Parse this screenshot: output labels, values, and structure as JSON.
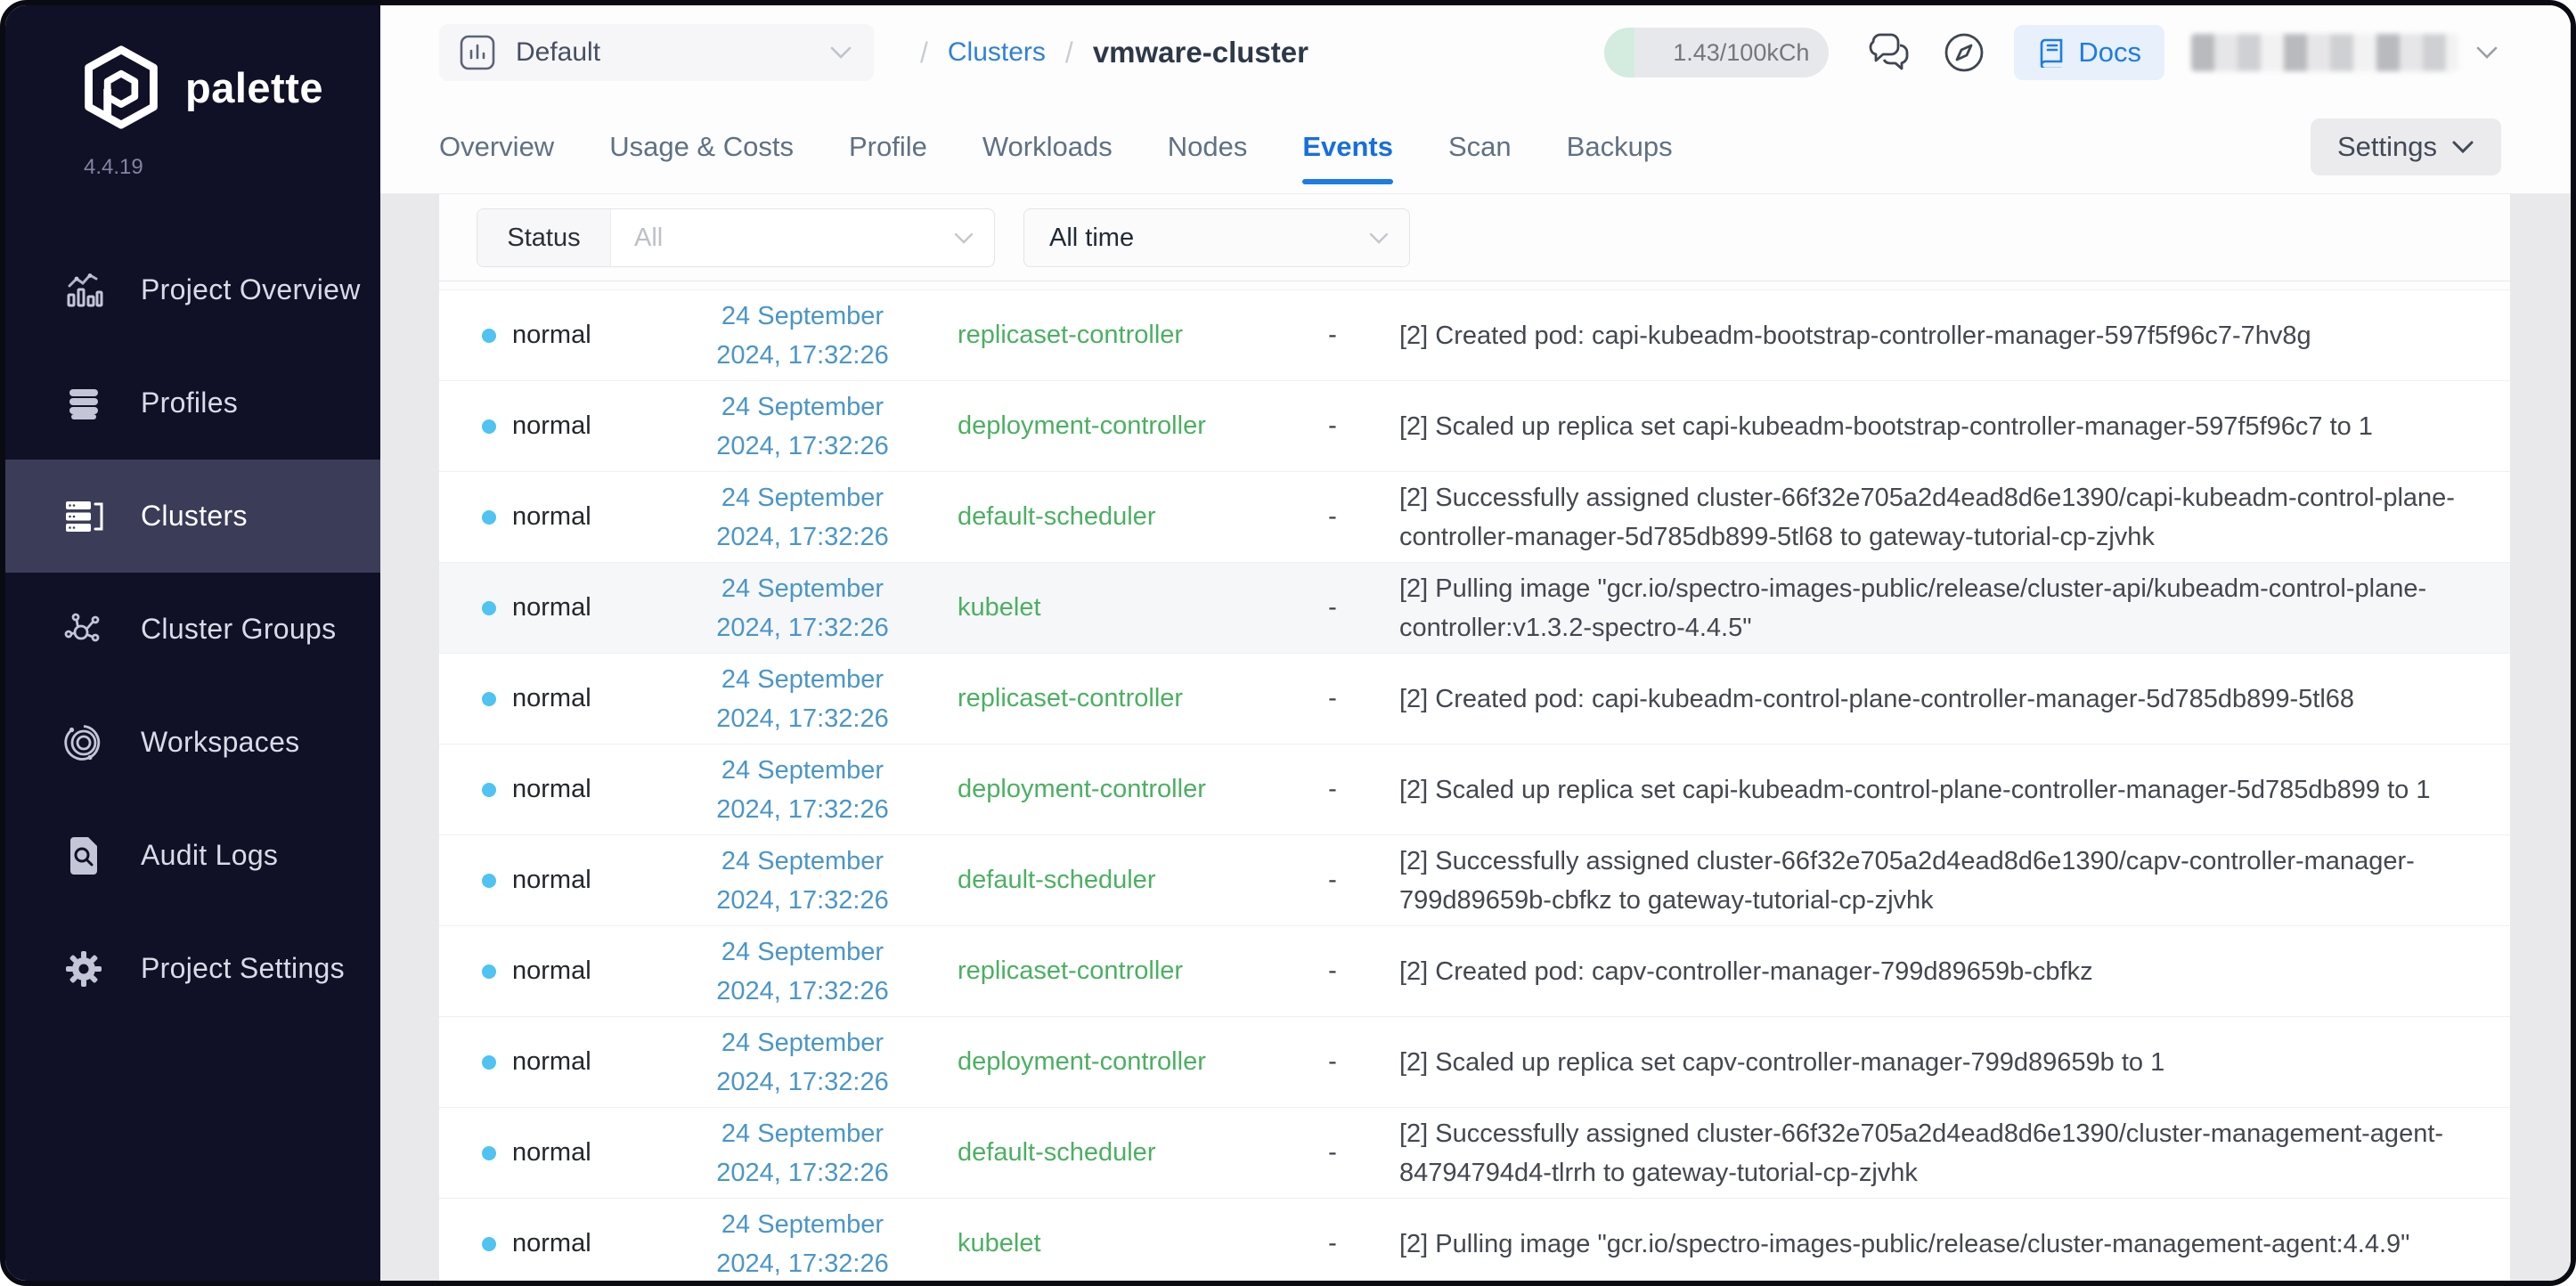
{
  "colors": {
    "accent_blue": "#1d7ce4",
    "date_blue": "#4a96c8",
    "source_green": "#4bb061",
    "status_dot_cyan": "#4fc3f1",
    "sidebar_bg": "#101027",
    "active_item_bg": "#3b3c58",
    "docs_blue": "#1e7ce4"
  },
  "sidebar": {
    "logo": "palette",
    "version": "4.4.19",
    "items": [
      {
        "label": "Project Overview",
        "icon": "bar-chart-icon"
      },
      {
        "label": "Profiles",
        "icon": "stack-icon"
      },
      {
        "label": "Clusters",
        "icon": "server-rack-icon",
        "active": true
      },
      {
        "label": "Cluster Groups",
        "icon": "network-nodes-icon"
      },
      {
        "label": "Workspaces",
        "icon": "orbit-icon"
      },
      {
        "label": "Audit Logs",
        "icon": "document-search-icon"
      },
      {
        "label": "Project Settings",
        "icon": "gear-icon"
      }
    ]
  },
  "topbar": {
    "project": "Default",
    "breadcrumb_sep": "/",
    "breadcrumb_link": "Clusters",
    "breadcrumb_current": "vmware-cluster",
    "usage": "1.43/100kCh",
    "docs_label": "Docs"
  },
  "tabs": [
    {
      "label": "Overview",
      "_name": "tab-overview"
    },
    {
      "label": "Usage & Costs",
      "_name": "tab-usage-costs"
    },
    {
      "label": "Profile",
      "_name": "tab-profile"
    },
    {
      "label": "Workloads",
      "_name": "tab-workloads"
    },
    {
      "label": "Nodes",
      "_name": "tab-nodes"
    },
    {
      "label": "Events",
      "_name": "tab-events",
      "_class": "active"
    },
    {
      "label": "Scan",
      "_name": "tab-scan"
    },
    {
      "label": "Backups",
      "_name": "tab-backups"
    }
  ],
  "settings_button": "Settings",
  "filters": {
    "status_label": "Status",
    "status_placeholder": "All",
    "time_value": "All time"
  },
  "rows": [
    {
      "status": "normal",
      "d1": "24 September",
      "d2": "2024, 17:32:26",
      "source": "replicaset-controller",
      "dash": "-",
      "message": "[2] Created pod: capi-kubeadm-bootstrap-controller-manager-597f5f96c7-7hv8g"
    },
    {
      "status": "normal",
      "d1": "24 September",
      "d2": "2024, 17:32:26",
      "source": "deployment-controller",
      "dash": "-",
      "message": "[2] Scaled up replica set capi-kubeadm-bootstrap-controller-manager-597f5f96c7 to 1"
    },
    {
      "status": "normal",
      "d1": "24 September",
      "d2": "2024, 17:32:26",
      "source": "default-scheduler",
      "dash": "-",
      "message": "[2] Successfully assigned cluster-66f32e705a2d4ead8d6e1390/capi-kubeadm-control-plane-controller-manager-5d785db899-5tl68 to gateway-tutorial-cp-zjvhk"
    },
    {
      "status": "normal",
      "d1": "24 September",
      "d2": "2024, 17:32:26",
      "source": "kubelet",
      "dash": "-",
      "message": "[2] Pulling image \"gcr.io/spectro-images-public/release/cluster-api/kubeadm-control-plane-controller:v1.3.2-spectro-4.4.5\"",
      "_class": "hover"
    },
    {
      "status": "normal",
      "d1": "24 September",
      "d2": "2024, 17:32:26",
      "source": "replicaset-controller",
      "dash": "-",
      "message": "[2] Created pod: capi-kubeadm-control-plane-controller-manager-5d785db899-5tl68"
    },
    {
      "status": "normal",
      "d1": "24 September",
      "d2": "2024, 17:32:26",
      "source": "deployment-controller",
      "dash": "-",
      "message": "[2] Scaled up replica set capi-kubeadm-control-plane-controller-manager-5d785db899 to 1"
    },
    {
      "status": "normal",
      "d1": "24 September",
      "d2": "2024, 17:32:26",
      "source": "default-scheduler",
      "dash": "-",
      "message": "[2] Successfully assigned cluster-66f32e705a2d4ead8d6e1390/capv-controller-manager-799d89659b-cbfkz to gateway-tutorial-cp-zjvhk"
    },
    {
      "status": "normal",
      "d1": "24 September",
      "d2": "2024, 17:32:26",
      "source": "replicaset-controller",
      "dash": "-",
      "message": "[2] Created pod: capv-controller-manager-799d89659b-cbfkz"
    },
    {
      "status": "normal",
      "d1": "24 September",
      "d2": "2024, 17:32:26",
      "source": "deployment-controller",
      "dash": "-",
      "message": "[2] Scaled up replica set capv-controller-manager-799d89659b to 1"
    },
    {
      "status": "normal",
      "d1": "24 September",
      "d2": "2024, 17:32:26",
      "source": "default-scheduler",
      "dash": "-",
      "message": "[2] Successfully assigned cluster-66f32e705a2d4ead8d6e1390/cluster-management-agent-84794794d4-tlrrh to gateway-tutorial-cp-zjvhk"
    },
    {
      "status": "normal",
      "d1": "24 September",
      "d2": "2024, 17:32:26",
      "source": "kubelet",
      "dash": "-",
      "message": "[2] Pulling image \"gcr.io/spectro-images-public/release/cluster-management-agent:4.4.9\""
    }
  ]
}
